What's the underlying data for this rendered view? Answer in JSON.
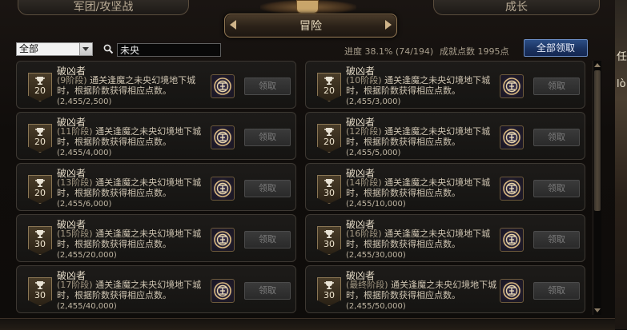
{
  "tabs": {
    "left": "军团/攻坚战",
    "right": "成长",
    "active": "冒险"
  },
  "filter": {
    "selected": "全部"
  },
  "search": {
    "value": "未央"
  },
  "summary": {
    "progress": "进度 38.1% (74/194)",
    "points": "成就点数 1995点",
    "claim_all": "全部领取"
  },
  "side_text": [
    "任",
    "lò"
  ],
  "cards": [
    {
      "title": "破凶者",
      "stage": "(9阶段)",
      "desc": " 通关逢魔之未央幻境地下城时，根据阶数获得相应点数。",
      "progress": "(2,455/2,500)",
      "points": "20",
      "claim": "领取"
    },
    {
      "title": "破凶者",
      "stage": "(10阶段)",
      "desc": " 通关逢魔之未央幻境地下城时，根据阶数获得相应点数。",
      "progress": "(2,455/3,000)",
      "points": "20",
      "claim": "领取"
    },
    {
      "title": "破凶者",
      "stage": "(11阶段)",
      "desc": " 通关逢魔之未央幻境地下城时，根据阶数获得相应点数。",
      "progress": "(2,455/4,000)",
      "points": "20",
      "claim": "领取"
    },
    {
      "title": "破凶者",
      "stage": "(12阶段)",
      "desc": " 通关逢魔之未央幻境地下城时，根据阶数获得相应点数。",
      "progress": "(2,455/5,000)",
      "points": "20",
      "claim": "领取"
    },
    {
      "title": "破凶者",
      "stage": "(13阶段)",
      "desc": " 通关逢魔之未央幻境地下城时，根据阶数获得相应点数。",
      "progress": "(2,455/6,000)",
      "points": "20",
      "claim": "领取"
    },
    {
      "title": "破凶者",
      "stage": "(14阶段)",
      "desc": " 通关逢魔之未央幻境地下城时，根据阶数获得相应点数。",
      "progress": "(2,455/10,000)",
      "points": "30",
      "claim": "领取"
    },
    {
      "title": "破凶者",
      "stage": "(15阶段)",
      "desc": " 通关逢魔之未央幻境地下城时，根据阶数获得相应点数。",
      "progress": "(2,455/20,000)",
      "points": "30",
      "claim": "领取"
    },
    {
      "title": "破凶者",
      "stage": "(16阶段)",
      "desc": " 通关逢魔之未央幻境地下城时，根据阶数获得相应点数。",
      "progress": "(2,455/30,000)",
      "points": "30",
      "claim": "领取"
    },
    {
      "title": "破凶者",
      "stage": "(17阶段)",
      "desc": " 通关逢魔之未央幻境地下城时，根据阶数获得相应点数。",
      "progress": "(2,455/40,000)",
      "points": "30",
      "claim": "领取"
    },
    {
      "title": "破凶者",
      "stage": "(最终阶段)",
      "desc": " 通关逢魔之未央幻境地下城时，根据阶数获得相应点数。",
      "progress": "(2,455/50,000)",
      "points": "30",
      "claim": "领取"
    }
  ]
}
